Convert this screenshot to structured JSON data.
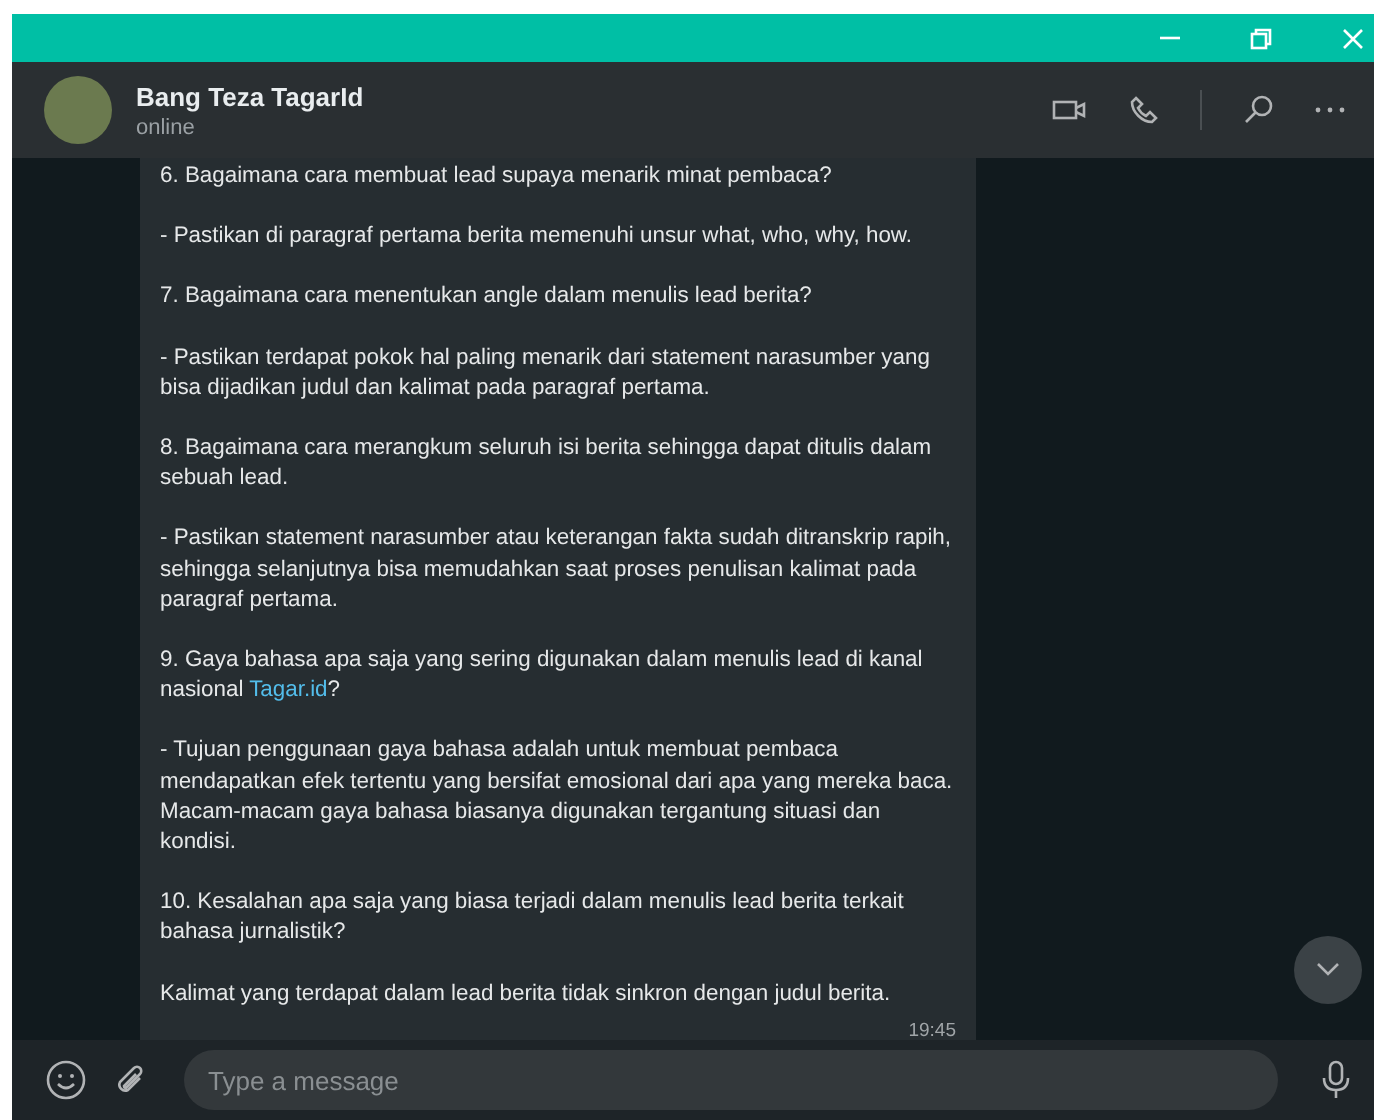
{
  "header": {
    "name": "Bang Teza TagarId",
    "status": "online"
  },
  "message": {
    "paragraphs": [
      [
        {
          "text": "6. Bagaimana cara membuat lead supaya menarik minat pembaca?"
        }
      ],
      [
        {
          "text": "- Pastikan di paragraf pertama berita memenuhi unsur what, who, why, how."
        }
      ],
      [
        {
          "text": "7. Bagaimana cara menentukan angle dalam menulis lead berita?"
        }
      ],
      [
        {
          "text": "- Pastikan terdapat pokok hal paling menarik dari statement narasumber yang bisa dijadikan judul dan kalimat pada paragraf pertama."
        }
      ],
      [
        {
          "text": "8. Bagaimana cara merangkum seluruh isi berita sehingga dapat ditulis dalam sebuah lead."
        }
      ],
      [
        {
          "text": "- Pastikan statement narasumber atau keterangan fakta sudah ditranskrip rapih, sehingga selanjutnya bisa memudahkan saat proses penulisan kalimat pada paragraf pertama."
        }
      ],
      [
        {
          "text": "9. Gaya bahasa apa saja yang sering digunakan dalam menulis lead di kanal nasional "
        },
        {
          "text": "Tagar.id",
          "kind": "link"
        },
        {
          "text": "?"
        }
      ],
      [
        {
          "text": "- Tujuan penggunaan gaya bahasa adalah untuk membuat pembaca mendapatkan efek tertentu yang bersifat emosional dari apa yang mereka baca. Macam-macam gaya bahasa biasanya digunakan tergantung situasi dan kondisi."
        }
      ],
      [
        {
          "text": "10. Kesalahan apa saja yang biasa terjadi dalam menulis lead berita terkait bahasa jurnalistik?"
        }
      ],
      [
        {
          "text": "Kalimat yang terdapat dalam lead berita tidak sinkron dengan judul berita."
        }
      ]
    ],
    "time": "19:45"
  },
  "composer": {
    "placeholder": "Type a message"
  }
}
